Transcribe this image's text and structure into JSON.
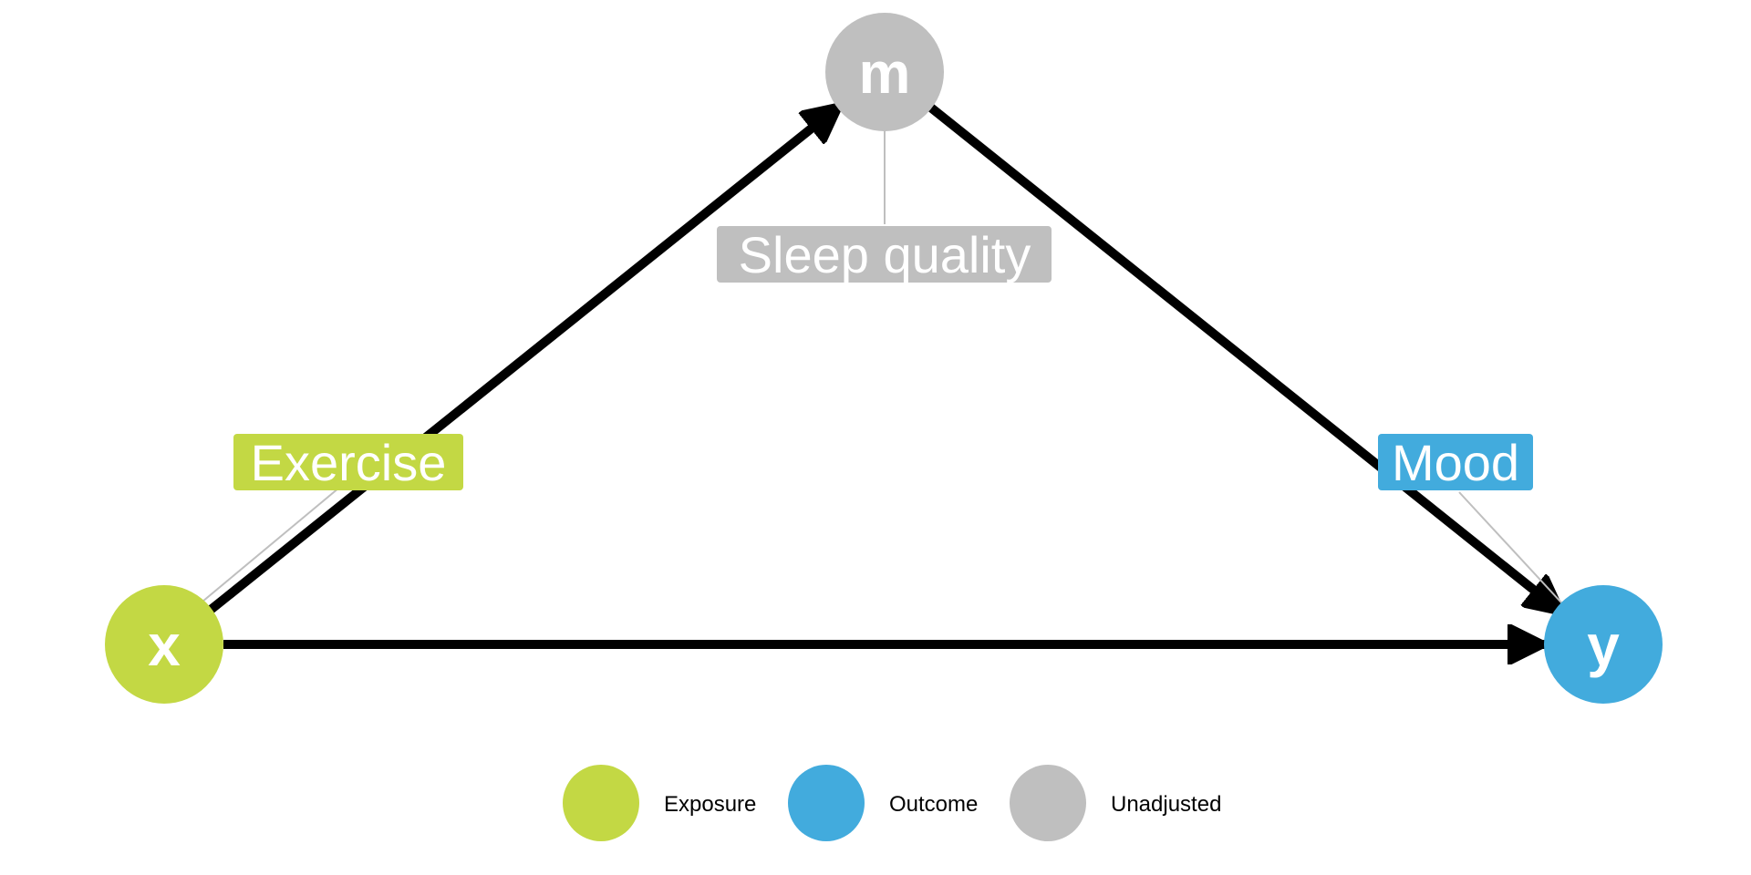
{
  "nodes": {
    "x": {
      "letter": "x",
      "label": "Exercise",
      "role": "exposure"
    },
    "m": {
      "letter": "m",
      "label": "Sleep quality",
      "role": "unadjusted"
    },
    "y": {
      "letter": "y",
      "label": "Mood",
      "role": "outcome"
    }
  },
  "edges": [
    {
      "from": "x",
      "to": "m"
    },
    {
      "from": "m",
      "to": "y"
    },
    {
      "from": "x",
      "to": "y"
    }
  ],
  "colors": {
    "exposure": "#c3d844",
    "outcome": "#42abdd",
    "unadjusted": "#bfbfbf",
    "edge": "#000000",
    "leader": "#bfbfbf"
  },
  "legend": {
    "items": [
      {
        "label": "Exposure",
        "role": "exposure"
      },
      {
        "label": "Outcome",
        "role": "outcome"
      },
      {
        "label": "Unadjusted",
        "role": "unadjusted"
      }
    ]
  }
}
